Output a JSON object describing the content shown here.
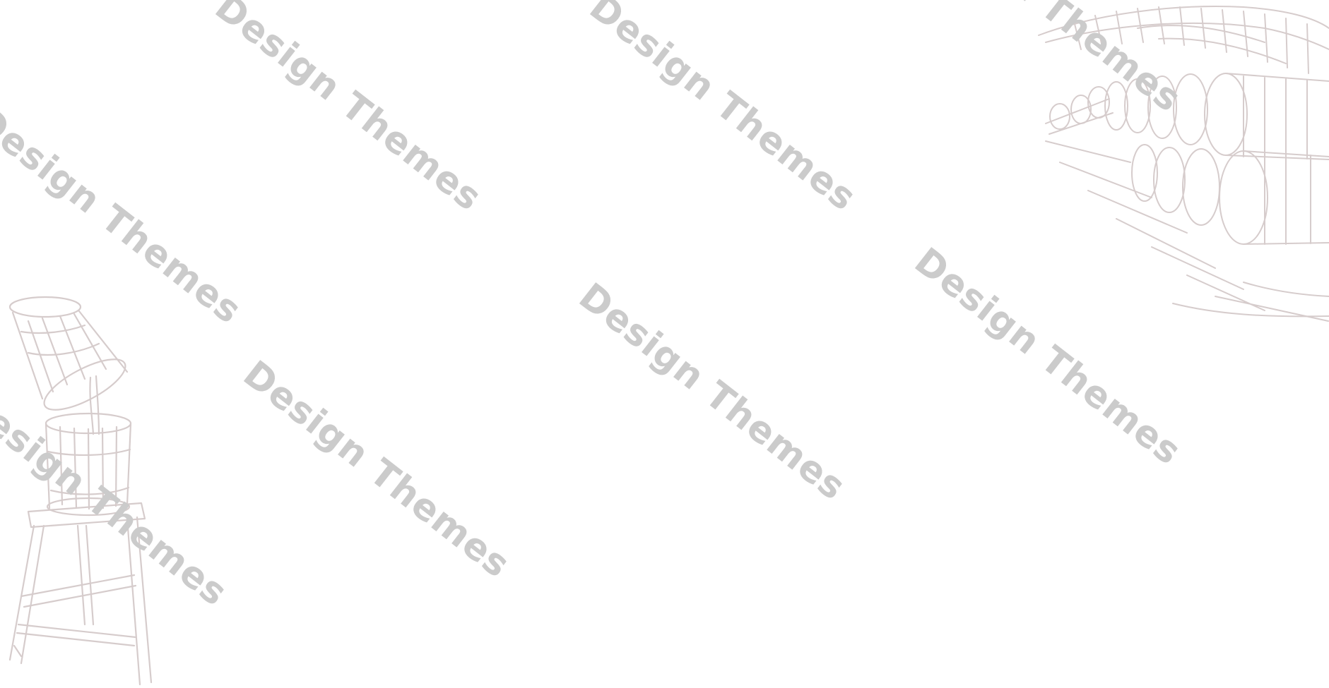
{
  "watermark_text": "Design Themes",
  "illustrations": {
    "left": {
      "subject": "wine-press-sketch",
      "color": "#d6cccc"
    },
    "right": {
      "subject": "wine-barrels-sketch",
      "color": "#d6cccc"
    }
  }
}
